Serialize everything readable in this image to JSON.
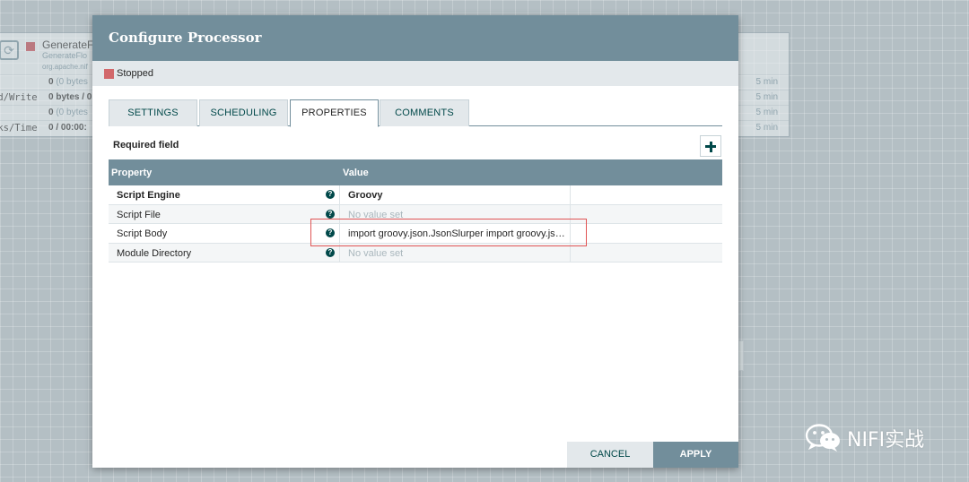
{
  "background_processor": {
    "name": "GenerateF",
    "type": "GenerateFlo",
    "bundle": "org.apache.nif",
    "stats": [
      {
        "label": "",
        "value": "0",
        "detail": "(0 bytes",
        "time": "5 min"
      },
      {
        "label": "ad/Write",
        "value": "0 bytes / 0",
        "detail": "",
        "time": "5 min"
      },
      {
        "label": "t",
        "value": "0",
        "detail": "(0 bytes",
        "time": "5 min"
      },
      {
        "label": "sks/Time",
        "value": "0 / 00:00:",
        "detail": "",
        "time": "5 min"
      }
    ]
  },
  "dialog": {
    "title": "Configure Processor",
    "status": "Stopped",
    "status_color": "#d2686b",
    "tabs": [
      {
        "label": "SETTINGS",
        "active": false
      },
      {
        "label": "SCHEDULING",
        "active": false
      },
      {
        "label": "PROPERTIES",
        "active": true
      },
      {
        "label": "COMMENTS",
        "active": false
      }
    ],
    "required_field_label": "Required field",
    "add_button_icon": "plus-icon",
    "grid": {
      "columns": [
        "Property",
        "Value"
      ],
      "rows": [
        {
          "property": "Script Engine",
          "value": "Groovy",
          "required": true,
          "empty": false
        },
        {
          "property": "Script File",
          "value": "No value set",
          "required": false,
          "empty": true
        },
        {
          "property": "Script Body",
          "value": "import groovy.json.JsonSlurper import groovy.json.JsonBuilder",
          "required": false,
          "empty": false
        },
        {
          "property": "Module Directory",
          "value": "No value set",
          "required": false,
          "empty": true
        }
      ]
    },
    "buttons": {
      "cancel": "CANCEL",
      "apply": "APPLY"
    }
  },
  "watermark": {
    "text": "NIFI实战",
    "icon": "wechat-icon"
  },
  "colors": {
    "header": "#728e9b",
    "accent": "#004849",
    "highlight": "#e05454"
  }
}
